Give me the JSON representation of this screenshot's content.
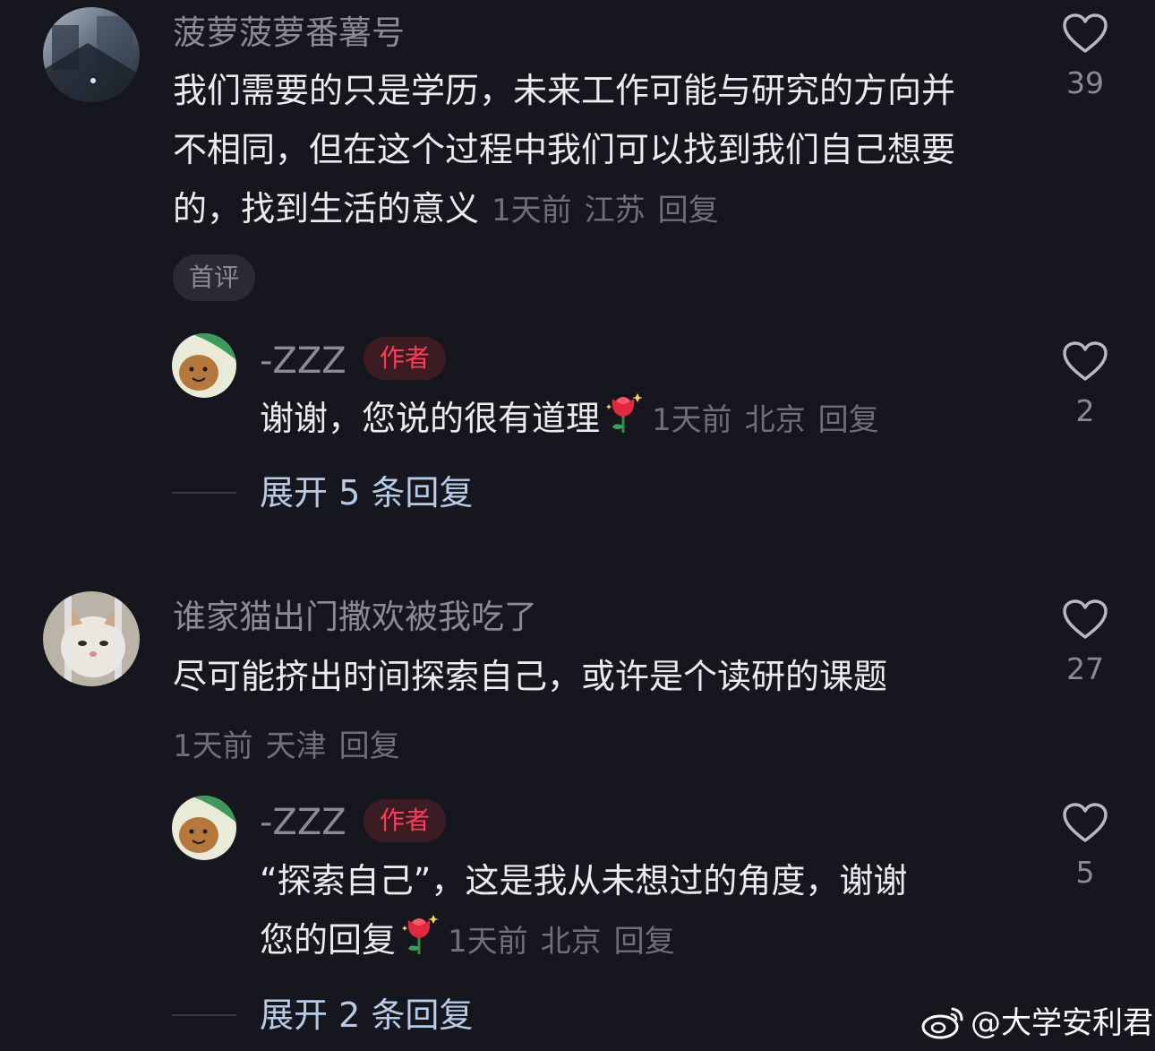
{
  "comments": [
    {
      "username": "菠萝菠萝番薯号",
      "text": "我们需要的只是学历，未来工作可能与研究的方向并不相同，但在这个过程中我们可以找到我们自己想要的，找到生活的意义",
      "time": "1天前",
      "location": "江苏",
      "reply_label": "回复",
      "badge": "首评",
      "likes": "39",
      "reply": {
        "username": "-ZZZ",
        "author_badge": "作者",
        "text": "谢谢，您说的很有道理",
        "time": "1天前",
        "location": "北京",
        "reply_label": "回复",
        "likes": "2"
      },
      "expand_label": "展开 5 条回复"
    },
    {
      "username": "谁家猫出门撒欢被我吃了",
      "text": "尽可能挤出时间探索自己，或许是个读研的课题",
      "time": "1天前",
      "location": "天津",
      "reply_label": "回复",
      "likes": "27",
      "reply": {
        "username": "-ZZZ",
        "author_badge": "作者",
        "text_line1": "“探索自己”，这是我从未想过的角度，谢谢",
        "text_line2": "您的回复",
        "time": "1天前",
        "location": "北京",
        "reply_label": "回复",
        "likes": "5"
      },
      "expand_label": "展开 2 条回复"
    }
  ],
  "icons": {
    "like": "heart-outline-icon",
    "emoji": "rose-emoji-icon",
    "watermark_logo": "weibo-logo-icon"
  },
  "watermark": {
    "text": "@大学安利君"
  },
  "colors": {
    "background": "#16161e",
    "author_badge": "#ff3b5c",
    "expand_link": "#b8cbe6"
  }
}
